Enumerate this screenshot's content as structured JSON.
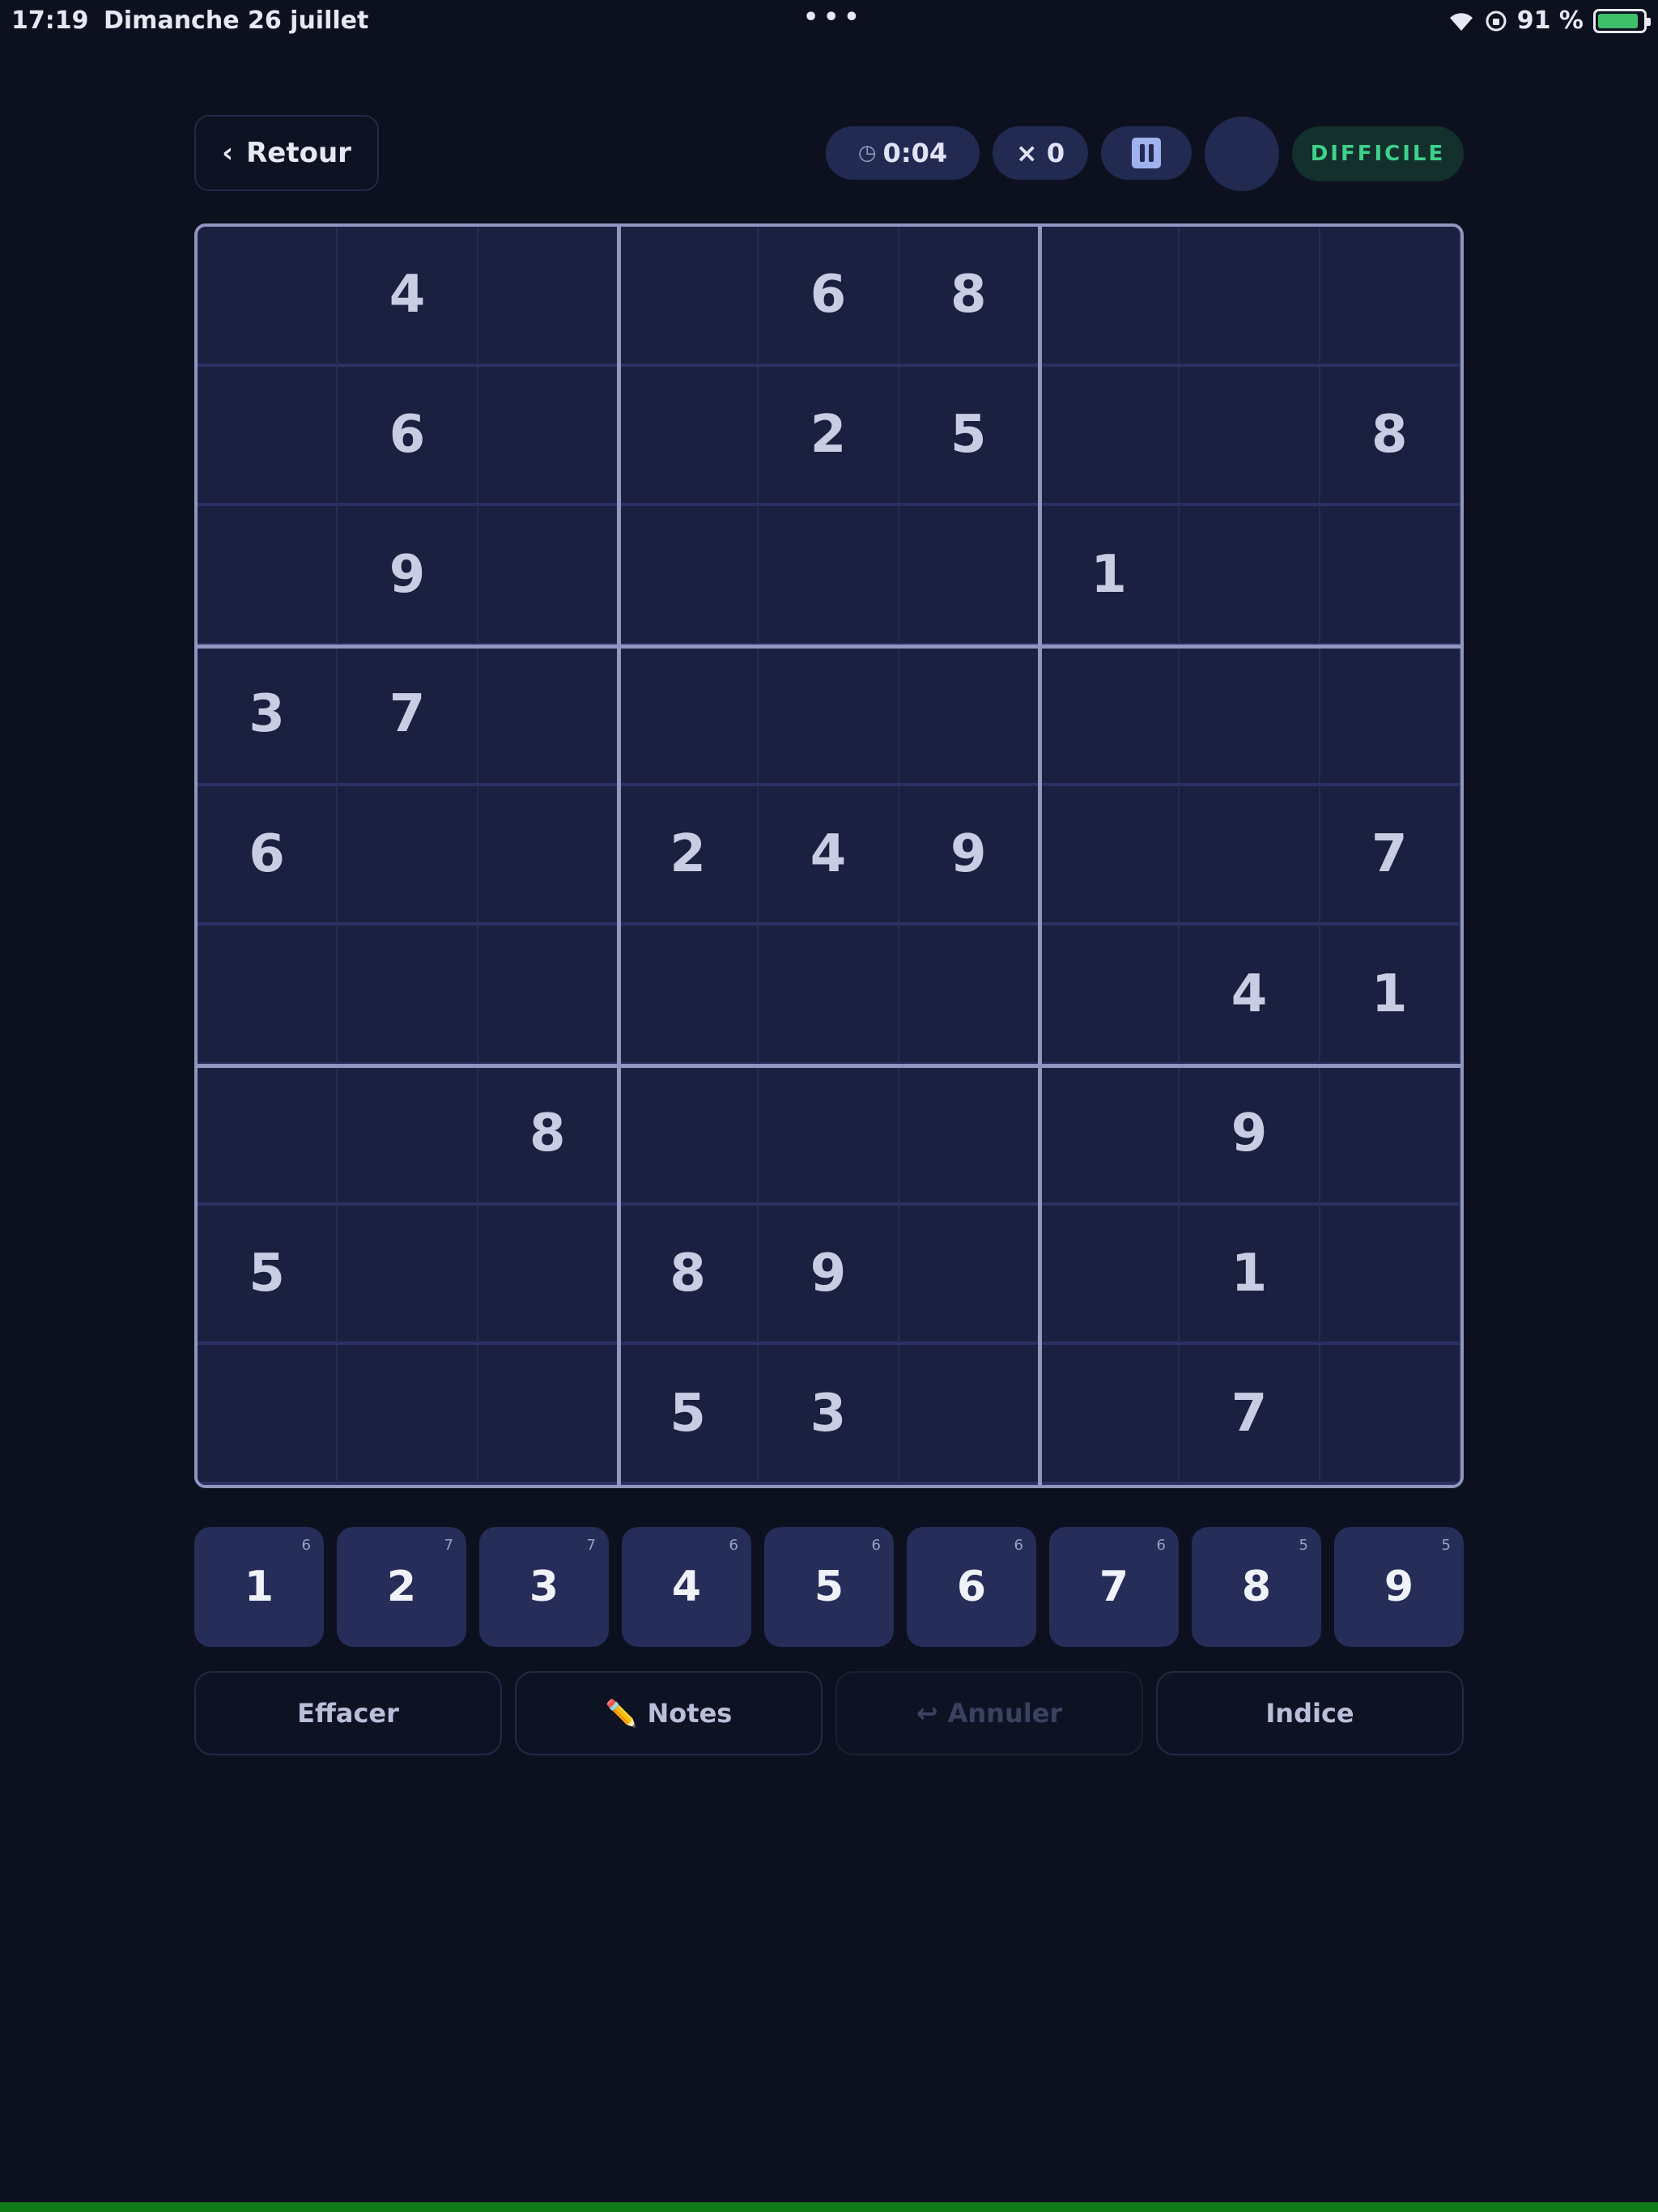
{
  "status_bar": {
    "time": "17:19",
    "date": "Dimanche 26 juillet",
    "dots": "•••",
    "battery_percent": "91 %",
    "battery_level": 0.91
  },
  "header": {
    "back_label": "Retour",
    "back_icon": "‹",
    "timer": "0:04",
    "timer_icon": "◷",
    "mistakes": "× 0",
    "difficulty": "DIFFICILE"
  },
  "board": {
    "rows": [
      [
        "",
        "4",
        "",
        "",
        "6",
        "8",
        "",
        "",
        ""
      ],
      [
        "",
        "6",
        "",
        "",
        "2",
        "5",
        "",
        "",
        "8"
      ],
      [
        "",
        "9",
        "",
        "",
        "",
        "",
        "1",
        "",
        ""
      ],
      [
        "3",
        "7",
        "",
        "",
        "",
        "",
        "",
        "",
        ""
      ],
      [
        "6",
        "",
        "",
        "2",
        "4",
        "9",
        "",
        "",
        "7"
      ],
      [
        "",
        "",
        "",
        "",
        "",
        "",
        "",
        "4",
        "1"
      ],
      [
        "",
        "",
        "8",
        "",
        "",
        "",
        "",
        "9",
        ""
      ],
      [
        "5",
        "",
        "",
        "8",
        "9",
        "",
        "",
        "1",
        ""
      ],
      [
        "",
        "",
        "",
        "5",
        "3",
        "",
        "",
        "7",
        ""
      ]
    ]
  },
  "numpad": [
    {
      "digit": "1",
      "count": "6"
    },
    {
      "digit": "2",
      "count": "7"
    },
    {
      "digit": "3",
      "count": "7"
    },
    {
      "digit": "4",
      "count": "6"
    },
    {
      "digit": "5",
      "count": "6"
    },
    {
      "digit": "6",
      "count": "6"
    },
    {
      "digit": "7",
      "count": "6"
    },
    {
      "digit": "8",
      "count": "5"
    },
    {
      "digit": "9",
      "count": "5"
    }
  ],
  "actions": {
    "erase": "Effacer",
    "notes_icon": "✏️",
    "notes": "Notes",
    "undo_icon": "↩",
    "undo": "Annuler",
    "hint": "Indice"
  },
  "colors": {
    "background": "#0d111f",
    "board": "#1b2040",
    "accent_difficulty": "#3ed18a"
  }
}
